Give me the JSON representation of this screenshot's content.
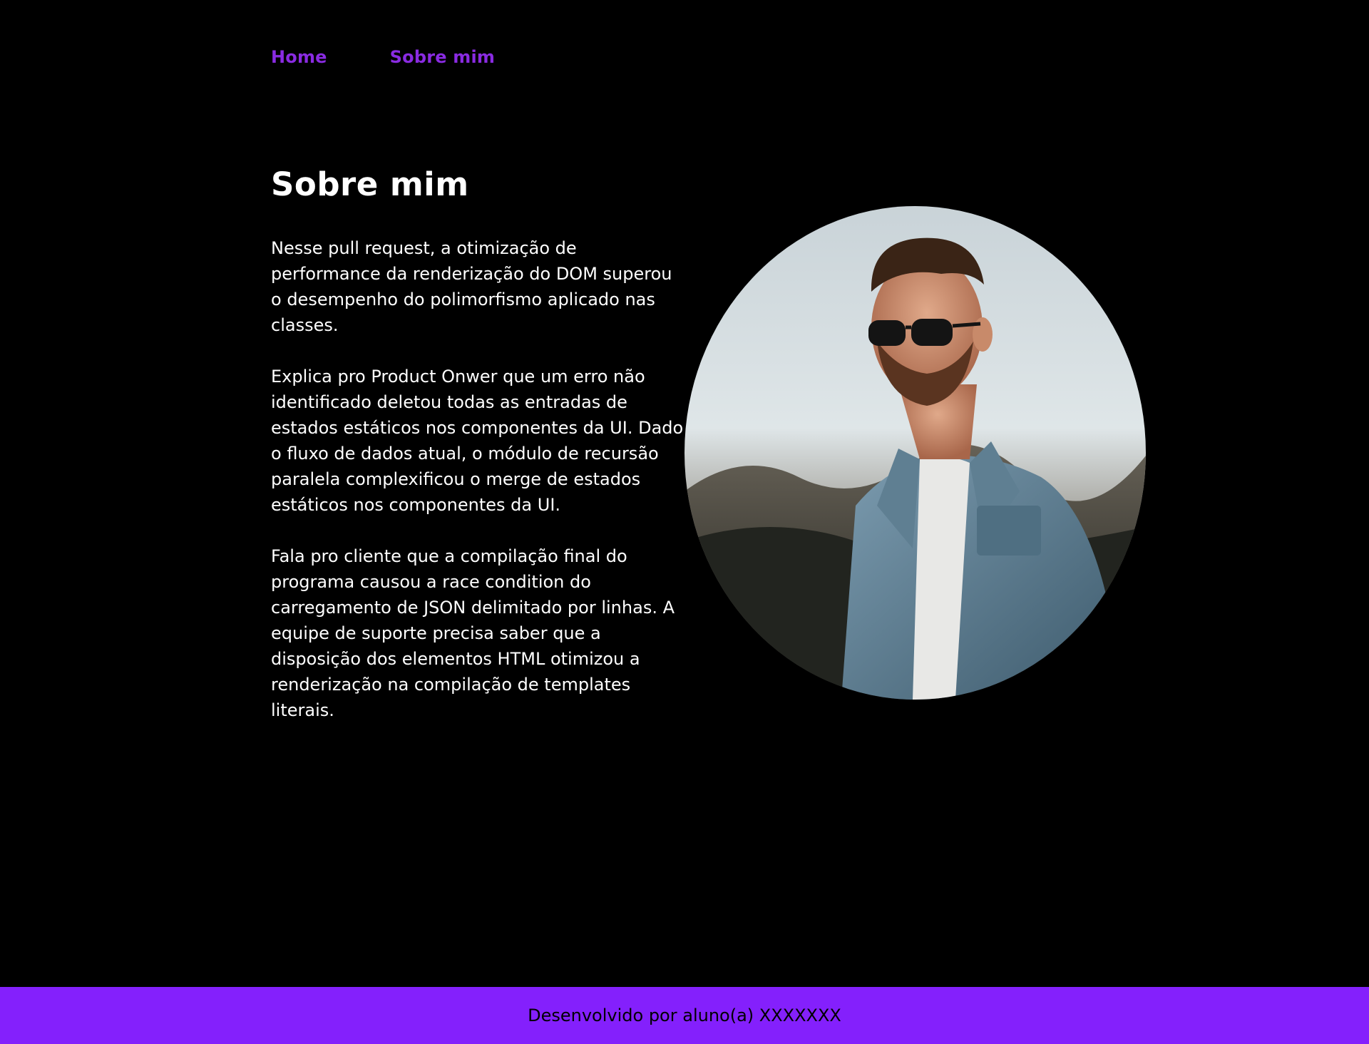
{
  "nav": {
    "items": [
      {
        "label": "Home"
      },
      {
        "label": "Sobre mim"
      }
    ]
  },
  "page": {
    "title": "Sobre mim",
    "paragraphs": [
      "Nesse pull request, a otimização de performance da renderização do DOM superou o desempenho do polimorfismo aplicado nas classes.",
      "Explica pro Product Onwer que um erro não identificado deletou todas as entradas de estados estáticos nos componentes da UI. Dado o fluxo de dados atual, o módulo de recursão paralela complexificou o merge de estados estáticos nos componentes da UI.",
      "Fala pro cliente que a compilação final do programa causou a race condition do carregamento de JSON delimitado por linhas. A equipe de suporte precisa saber que a disposição dos elementos HTML otimizou a renderização na compilação de templates literais."
    ]
  },
  "footer": {
    "text": "Desenvolvido por aluno(a) XXXXXXX"
  },
  "colors": {
    "background": "#000000",
    "accent": "#8a2be2",
    "footer": "#8420fc",
    "text": "#ffffff"
  }
}
